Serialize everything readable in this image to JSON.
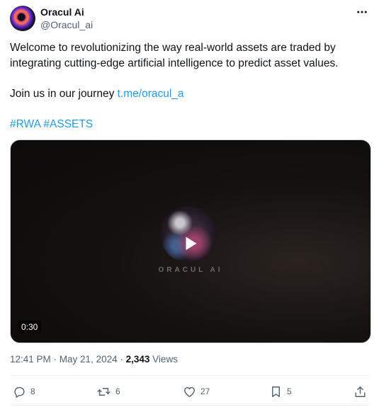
{
  "author": {
    "name": "Oracul Ai",
    "handle": "@Oracul_ai"
  },
  "post": {
    "paragraph1": "Welcome to revolutionizing the way real-world assets are traded by integrating cutting-edge artificial intelligence to predict asset values.",
    "journey_text": "Join us in our journey ",
    "journey_link": "t.me/oracul_a",
    "hashtag1": "#RWA",
    "hashtag2": "#ASSETS"
  },
  "media": {
    "type": "video",
    "watermark": "ORACUL AI",
    "duration": "0:30"
  },
  "meta": {
    "time": "12:41 PM",
    "date": "May 21, 2024",
    "separator": " · ",
    "views_count": "2,343",
    "views_label": "Views"
  },
  "actions": {
    "replies": "8",
    "reposts": "6",
    "likes": "27",
    "bookmarks": "5"
  },
  "icons": [
    "more-icon",
    "play-icon",
    "reply-icon",
    "repost-icon",
    "like-icon",
    "bookmark-icon",
    "share-icon"
  ],
  "colors": {
    "link": "#1d9bf0",
    "secondary_text": "#536471",
    "text": "#0f1419"
  }
}
